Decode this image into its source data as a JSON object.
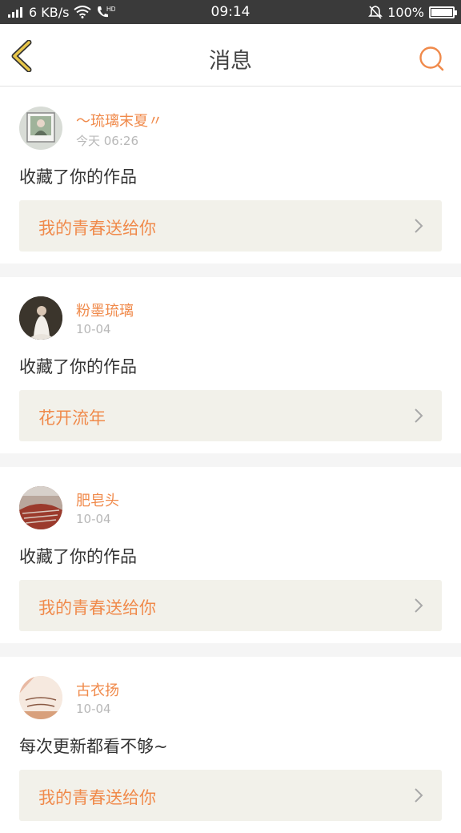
{
  "status_bar": {
    "network_type": "4G",
    "speed": "6 KB/s",
    "hd_label": "HD",
    "time": "09:14",
    "battery": "100%",
    "icons": [
      "signal-icon",
      "wifi-icon",
      "call-hd-icon",
      "mute-bell-icon",
      "battery-icon"
    ]
  },
  "nav": {
    "title": "消息",
    "back_icon": "chevron-left-icon",
    "search_icon": "search-icon"
  },
  "colors": {
    "accent": "#f08a4b",
    "back_icon": "#e8c64a",
    "status_bar": "#3a3a3a",
    "work_box": "#f2f1ea",
    "divider": "#f5f5f5"
  },
  "messages": [
    {
      "user": "～琉璃末夏〃",
      "time": "今天 06:26",
      "action": "收藏了你的作品",
      "work": "我的青春送给你"
    },
    {
      "user": "粉墨琉璃",
      "time": "10-04",
      "action": "收藏了你的作品",
      "work": "花开流年"
    },
    {
      "user": "肥皂头",
      "time": "10-04",
      "action": "收藏了你的作品",
      "work": "我的青春送给你"
    },
    {
      "user": "古衣扬",
      "time": "10-04",
      "action": "每次更新都看不够~",
      "work": "我的青春送给你"
    }
  ]
}
